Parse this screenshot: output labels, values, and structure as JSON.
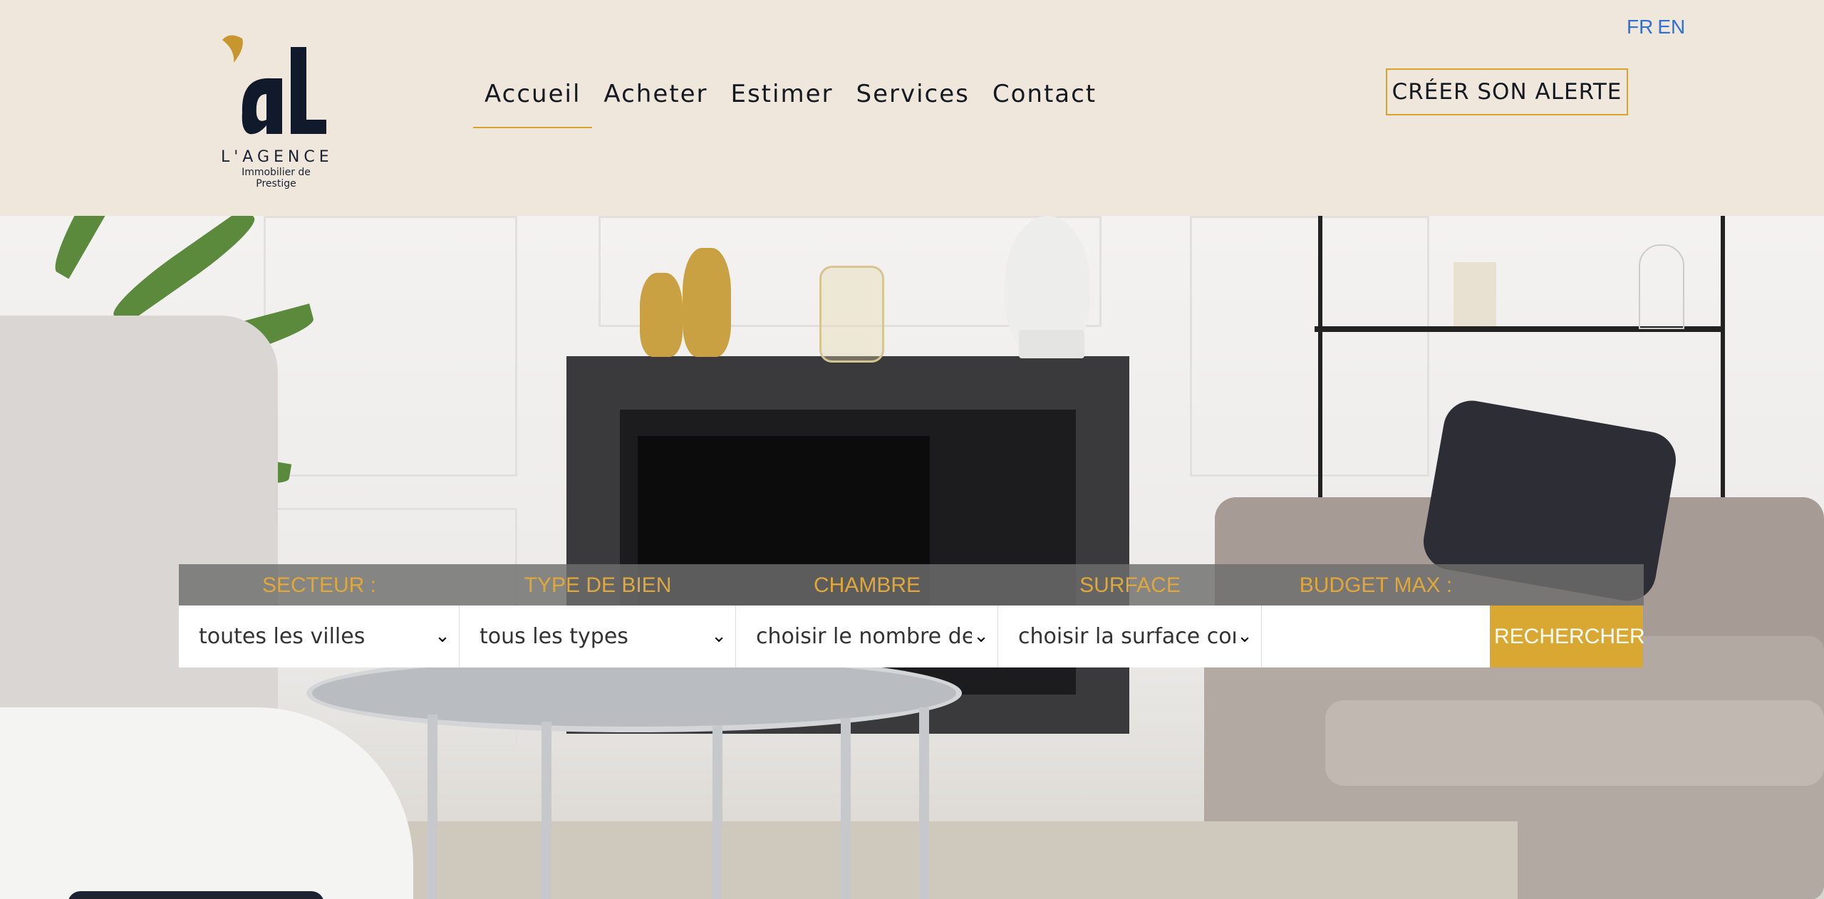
{
  "logo": {
    "name": "L'AGENCE",
    "tagline": "Immobilier de Prestige"
  },
  "nav": {
    "items": [
      {
        "label": "Accueil",
        "active": true
      },
      {
        "label": "Acheter"
      },
      {
        "label": "Estimer"
      },
      {
        "label": "Services"
      },
      {
        "label": "Contact"
      }
    ]
  },
  "lang": {
    "fr": "FR",
    "en": "EN"
  },
  "alert_button": "CRÉER SON ALERTE",
  "search": {
    "labels": {
      "secteur": "SECTEUR :",
      "type": "TYPE DE BIEN",
      "chambre": "CHAMBRE",
      "surface": "SURFACE",
      "budget": "BUDGET MAX :"
    },
    "values": {
      "secteur": "toutes les villes",
      "type": "tous les types",
      "chambre": "choisir le nombre de",
      "surface": "choisir la surface cor",
      "budget": ""
    },
    "button": "RECHERCHER"
  },
  "colors": {
    "accent": "#d9a832",
    "header_bg": "#efe7db",
    "text_dark": "#151a22",
    "lang_link": "#2f6fd6"
  }
}
